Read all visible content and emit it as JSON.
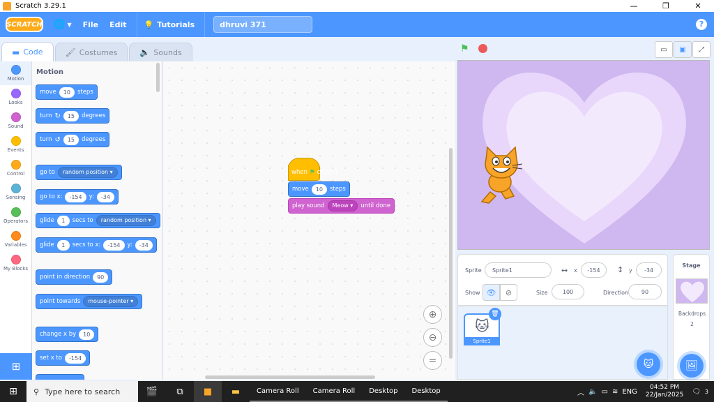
{
  "window": {
    "title": "Scratch 3.29.1",
    "controls": [
      "—",
      "❐",
      "✕"
    ]
  },
  "menubar": {
    "logo": "SCRATCH",
    "file": "File",
    "edit": "Edit",
    "tutorials": "Tutorials",
    "project_title": "dhruvi 371",
    "help": "?"
  },
  "tabs": [
    {
      "label": "Code",
      "icon": "code-icon"
    },
    {
      "label": "Costumes",
      "icon": "brush-icon"
    },
    {
      "label": "Sounds",
      "icon": "speaker-icon"
    }
  ],
  "categories": [
    {
      "label": "Motion",
      "color": "#4c97ff"
    },
    {
      "label": "Looks",
      "color": "#9966ff"
    },
    {
      "label": "Sound",
      "color": "#cf63cf"
    },
    {
      "label": "Events",
      "color": "#ffbf00"
    },
    {
      "label": "Control",
      "color": "#ffab19"
    },
    {
      "label": "Sensing",
      "color": "#5cb1d6"
    },
    {
      "label": "Operators",
      "color": "#59c059"
    },
    {
      "label": "Variables",
      "color": "#ff8c1a"
    },
    {
      "label": "My Blocks",
      "color": "#ff6680"
    }
  ],
  "palette": {
    "heading": "Motion",
    "move": {
      "pre": "move",
      "val": "10",
      "post": "steps"
    },
    "turn_right": {
      "pre": "turn",
      "val": "15",
      "post": "degrees"
    },
    "turn_left": {
      "pre": "turn",
      "val": "15",
      "post": "degrees"
    },
    "go_to": {
      "pre": "go to",
      "drop": "random position"
    },
    "go_to_xy": {
      "pre": "go to x:",
      "x": "-154",
      "mid": "y:",
      "y": "-34"
    },
    "glide_to": {
      "pre": "glide",
      "val": "1",
      "mid": "secs to",
      "drop": "random position"
    },
    "glide_xy": {
      "pre": "glide",
      "val": "1",
      "mid": "secs to x:",
      "x": "-154",
      "mid2": "y:",
      "y": "-34"
    },
    "point_dir": {
      "pre": "point in direction",
      "val": "90"
    },
    "point_towards": {
      "pre": "point towards",
      "drop": "mouse-pointer"
    },
    "change_x": {
      "pre": "change x by",
      "val": "10"
    },
    "set_x": {
      "pre": "set x to",
      "val": "-154"
    }
  },
  "script": {
    "hat": {
      "pre": "when",
      "post": "clicked"
    },
    "move": {
      "pre": "move",
      "val": "10",
      "post": "steps"
    },
    "sound": {
      "pre": "play sound",
      "drop": "Meow",
      "post": "until done"
    }
  },
  "sprite_info": {
    "sprite_label": "Sprite",
    "sprite_name": "Sprite1",
    "x_label": "x",
    "x": "-154",
    "y_label": "y",
    "y": "-34",
    "show_label": "Show",
    "size_label": "Size",
    "size": "100",
    "direction_label": "Direction",
    "direction": "90"
  },
  "sprite_list": {
    "items": [
      {
        "name": "Sprite1"
      }
    ]
  },
  "stage_pane": {
    "heading": "Stage",
    "backdrops_label": "Backdrops",
    "backdrops_count": "2"
  },
  "taskbar": {
    "search_placeholder": "Type here to search",
    "folders": [
      "Camera Roll",
      "Camera Roll",
      "Desktop",
      "Desktop"
    ],
    "lang": "ENG",
    "time": "04:52 PM",
    "date": "22/Jan/2025",
    "notif_count": "3"
  }
}
